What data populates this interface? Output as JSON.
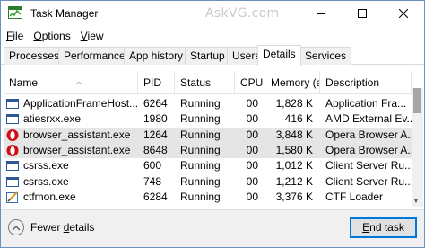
{
  "window": {
    "title": "Task Manager",
    "watermark": "AskVG.com",
    "icon": "task-manager-icon",
    "controls": {
      "minimize": "minimize-icon",
      "maximize": "maximize-icon",
      "close": "close-icon"
    }
  },
  "menu": {
    "file": {
      "hotkey": "F",
      "rest": "ile"
    },
    "options": {
      "hotkey": "O",
      "rest": "ptions"
    },
    "view": {
      "hotkey": "V",
      "rest": "iew"
    }
  },
  "tabs": [
    "Processes",
    "Performance",
    "App history",
    "Startup",
    "Users",
    "Details",
    "Services"
  ],
  "active_tab": "Details",
  "table": {
    "columns": [
      "Name",
      "PID",
      "Status",
      "CPU",
      "Memory (a...",
      "Description"
    ],
    "rows": [
      {
        "icon": "app-window-icon",
        "name": "ApplicationFrameHost....",
        "pid": "6264",
        "status": "Running",
        "cpu": "00",
        "memory": "1,828 K",
        "description": "Application Fra...",
        "selected": false
      },
      {
        "icon": "app-window-icon",
        "name": "atiesrxx.exe",
        "pid": "1980",
        "status": "Running",
        "cpu": "00",
        "memory": "416 K",
        "description": "AMD External Ev...",
        "selected": false
      },
      {
        "icon": "opera-icon",
        "name": "browser_assistant.exe",
        "pid": "1264",
        "status": "Running",
        "cpu": "00",
        "memory": "3,848 K",
        "description": "Opera Browser A...",
        "selected": true
      },
      {
        "icon": "opera-icon",
        "name": "browser_assistant.exe",
        "pid": "8648",
        "status": "Running",
        "cpu": "00",
        "memory": "1,580 K",
        "description": "Opera Browser A...",
        "selected": true
      },
      {
        "icon": "app-window-icon",
        "name": "csrss.exe",
        "pid": "600",
        "status": "Running",
        "cpu": "00",
        "memory": "1,012 K",
        "description": "Client Server Ru...",
        "selected": false
      },
      {
        "icon": "app-window-icon",
        "name": "csrss.exe",
        "pid": "748",
        "status": "Running",
        "cpu": "00",
        "memory": "1,212 K",
        "description": "Client Server Ru...",
        "selected": false
      },
      {
        "icon": "ctf-loader-icon",
        "name": "ctfmon.exe",
        "pid": "6284",
        "status": "Running",
        "cpu": "00",
        "memory": "3,376 K",
        "description": "CTF Loader",
        "selected": false
      }
    ]
  },
  "footer": {
    "fewer_details": {
      "hotkey": "d",
      "before": "Fewer ",
      "after": "etails"
    },
    "end_task": {
      "hotkey": "E",
      "rest": "nd task"
    }
  },
  "colors": {
    "selected_row": "#e5e5e5",
    "opera_red": "#cc0f16",
    "button_border": "#0078d7"
  }
}
